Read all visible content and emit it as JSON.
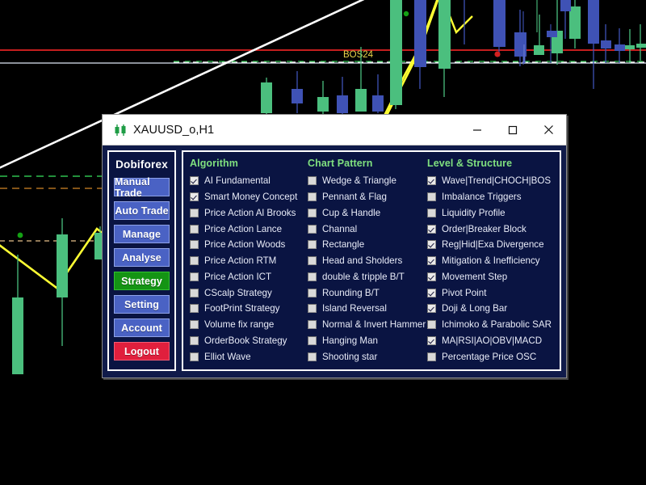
{
  "window": {
    "title": "XAUUSD_o,H1",
    "icon": "candlestick-icon",
    "controls": {
      "minimize": "—",
      "maximize": "□",
      "close": "✕"
    }
  },
  "sidebar": {
    "brand": "Dobiforex",
    "items": [
      {
        "label": "Manual Trade",
        "state": "normal"
      },
      {
        "label": "Auto Trade",
        "state": "normal"
      },
      {
        "label": "Manage",
        "state": "normal"
      },
      {
        "label": "Analyse",
        "state": "normal"
      },
      {
        "label": "Strategy",
        "state": "active"
      },
      {
        "label": "Setting",
        "state": "normal"
      },
      {
        "label": "Account",
        "state": "normal"
      },
      {
        "label": "Logout",
        "state": "danger"
      }
    ]
  },
  "columns": [
    {
      "header": "Algorithm",
      "options": [
        {
          "label": "AI Fundamental",
          "checked": true
        },
        {
          "label": "Smart Money Concept",
          "checked": true
        },
        {
          "label": "Price Action Al Brooks",
          "checked": false
        },
        {
          "label": "Price Action Lance",
          "checked": false
        },
        {
          "label": "Price Action Woods",
          "checked": false
        },
        {
          "label": "Price Action RTM",
          "checked": false
        },
        {
          "label": "Price Action ICT",
          "checked": false
        },
        {
          "label": "CScalp Strategy",
          "checked": false
        },
        {
          "label": "FootPrint Strategy",
          "checked": false
        },
        {
          "label": "Volume fix range",
          "checked": false
        },
        {
          "label": "OrderBook Strategy",
          "checked": false
        },
        {
          "label": "Elliot Wave",
          "checked": false
        }
      ]
    },
    {
      "header": "Chart Pattern",
      "options": [
        {
          "label": "Wedge & Triangle",
          "checked": false
        },
        {
          "label": "Pennant & Flag",
          "checked": false
        },
        {
          "label": "Cup & Handle",
          "checked": false
        },
        {
          "label": "Channal",
          "checked": false
        },
        {
          "label": "Rectangle",
          "checked": false
        },
        {
          "label": "Head and Sholders",
          "checked": false
        },
        {
          "label": "double & tripple B/T",
          "checked": false
        },
        {
          "label": "Rounding B/T",
          "checked": false
        },
        {
          "label": "Island Reversal",
          "checked": false
        },
        {
          "label": "Normal & Invert Hammer",
          "checked": false
        },
        {
          "label": "Hanging Man",
          "checked": false
        },
        {
          "label": "Shooting star",
          "checked": false
        }
      ]
    },
    {
      "header": "Level & Structure",
      "options": [
        {
          "label": "Wave|Trend|CHOCH|BOS",
          "checked": true
        },
        {
          "label": "Imbalance Triggers",
          "checked": false
        },
        {
          "label": "Liquidity Profile",
          "checked": false
        },
        {
          "label": "Order|Breaker Block",
          "checked": true
        },
        {
          "label": "Reg|Hid|Exa Divergence",
          "checked": true
        },
        {
          "label": "Mitigation & Inefficiency",
          "checked": true
        },
        {
          "label": "Movement Step",
          "checked": true
        },
        {
          "label": "Pivot Point",
          "checked": true
        },
        {
          "label": "Doji & Long Bar",
          "checked": true
        },
        {
          "label": "Ichimoko & Parabolic SAR",
          "checked": false
        },
        {
          "label": "MA|RSI|AO|OBV|MACD",
          "checked": true
        },
        {
          "label": "Percentage Price OSC",
          "checked": false
        }
      ]
    }
  ],
  "chart": {
    "annotation_label": "BOS24",
    "colors": {
      "background": "#000000",
      "bull_candle": "#4bbf7e",
      "bear_candle": "#3f52b5",
      "resistance_line": "#c41e1e",
      "support_line": "#b9c0cc",
      "zigzag": "#ffff33",
      "trendline": "#ffffff",
      "dashed_green": "#2fbf4f",
      "dashed_orange": "#b07020",
      "label_text": "#e8d44a",
      "marker_buy": "#14a014",
      "marker_sell": "#d31f1f"
    }
  }
}
